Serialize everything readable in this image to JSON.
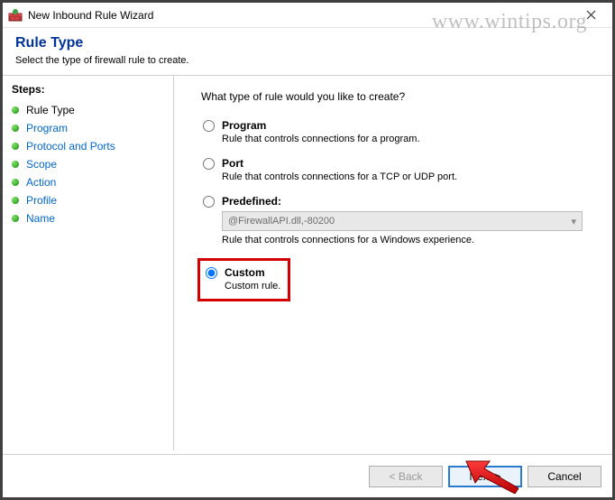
{
  "watermark": "www.wintips.org",
  "titlebar": {
    "title": "New Inbound Rule Wizard"
  },
  "header": {
    "heading": "Rule Type",
    "subtitle": "Select the type of firewall rule to create."
  },
  "sidebar": {
    "steps_label": "Steps:",
    "items": [
      {
        "label": "Rule Type",
        "active": true
      },
      {
        "label": "Program",
        "active": false
      },
      {
        "label": "Protocol and Ports",
        "active": false
      },
      {
        "label": "Scope",
        "active": false
      },
      {
        "label": "Action",
        "active": false
      },
      {
        "label": "Profile",
        "active": false
      },
      {
        "label": "Name",
        "active": false
      }
    ]
  },
  "main": {
    "question": "What type of rule would you like to create?",
    "options": {
      "program": {
        "title": "Program",
        "desc": "Rule that controls connections for a program."
      },
      "port": {
        "title": "Port",
        "desc": "Rule that controls connections for a TCP or UDP port."
      },
      "predefined": {
        "title": "Predefined:",
        "select_value": "@FirewallAPI.dll,-80200",
        "desc": "Rule that controls connections for a Windows experience."
      },
      "custom": {
        "title": "Custom",
        "desc": "Custom rule."
      }
    }
  },
  "footer": {
    "back": "< Back",
    "next": "Next >",
    "cancel": "Cancel"
  }
}
